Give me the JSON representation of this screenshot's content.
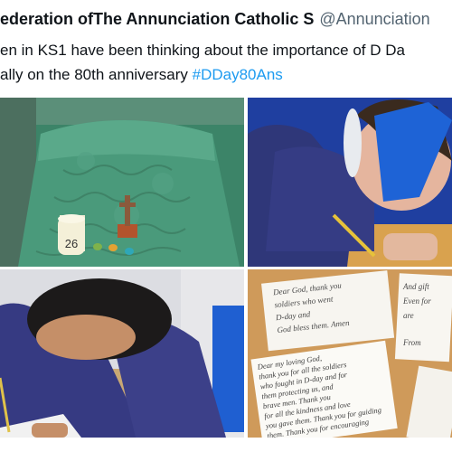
{
  "tweet": {
    "author_name": "ederation ofThe Annunciation Catholic S",
    "author_handle": "@Annunciation",
    "text_line1": "en in KS1 have been thinking about the importance of D Da",
    "text_line2_prefix": "ally on the 80th anniversary ",
    "hashtag": "#DDay80Ans"
  },
  "photos": {
    "candle_number": "26",
    "prayer_card_front": [
      "Dear my loving God,",
      "thank you for all the soldiers",
      "who fought in D-day and for",
      "them protecting us, and",
      "brave men. Thank you",
      "for all the kindness and love",
      "you gave them. Thank you for guiding",
      "them. Thank you for encouraging"
    ],
    "prayer_card_back": [
      "Dear God, thank you",
      "soldiers who went",
      "D-day and",
      "God bless them. Amen"
    ],
    "prayer_card_right": [
      "And gift",
      "Even for",
      "are",
      "From"
    ]
  },
  "colors": {
    "cloth": "#3f8a6e",
    "uniform": "#3b3f86",
    "table": "#d9a45a",
    "hashtag": "#1d9bf0"
  }
}
